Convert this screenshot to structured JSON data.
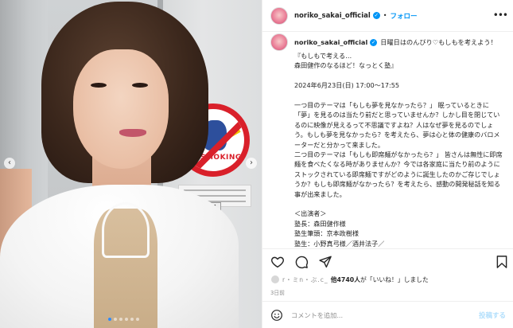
{
  "photo": {
    "sticker_text": "NO SMOKING",
    "door_plate": "51",
    "slide_count": 6,
    "active_slide": 1
  },
  "header": {
    "username": "noriko_sakai_official",
    "separator": "•",
    "follow_label": "フォロー",
    "more_label": "•••"
  },
  "caption": {
    "username": "noriko_sakai_official",
    "first_line": "日曜日はのんびり♡もしもを考えよう！",
    "lines": [
      "『もしもで考える…",
      "森田健作のなるほど！なっとく塾』",
      "",
      "2024年6月23日(日) 17:00〜17:55",
      "",
      "一つ目のテーマは「もしも夢を見なかったら？」 眠っているときに「夢」を見るのは当たり前だと思っていませんか？しかし目を閉じているのに映像が見えるって不思議ですよね？人はなぜ夢を見るのでしょう。もしも夢を見なかったら？を考えたら、夢は心と体の健康のバロメーターだと分かって来ました。",
      "二つ目のテーマは「もしも即席麺がなかったら？」 皆さんは無性に即席麺を食べたくなる時がありませんか？今では各家庭に当たり前のようにストックされている即席麺ですがどのように誕生したのかご存じでしょうか？もしも即席麺がなかったら？を考えたら、感動の開発秘話を知る事が出来ました。",
      "",
      "＜出演者＞",
      "塾長：森田健作様",
      "塾生筆頭：京本政樹様",
      "塾生：小野真弓様／酒井法子／"
    ]
  },
  "likes": {
    "liker_name": "r・ミn・ぶ.c_",
    "count_text": "他4740人",
    "suffix": "が「いいね！」しました"
  },
  "time_ago": "3日前",
  "comment": {
    "placeholder": "コメントを追加...",
    "post_label": "投稿する"
  },
  "colors": {
    "accent": "#0095f6",
    "post_disabled": "#b2dffc",
    "sticker_red": "#d9202a"
  }
}
